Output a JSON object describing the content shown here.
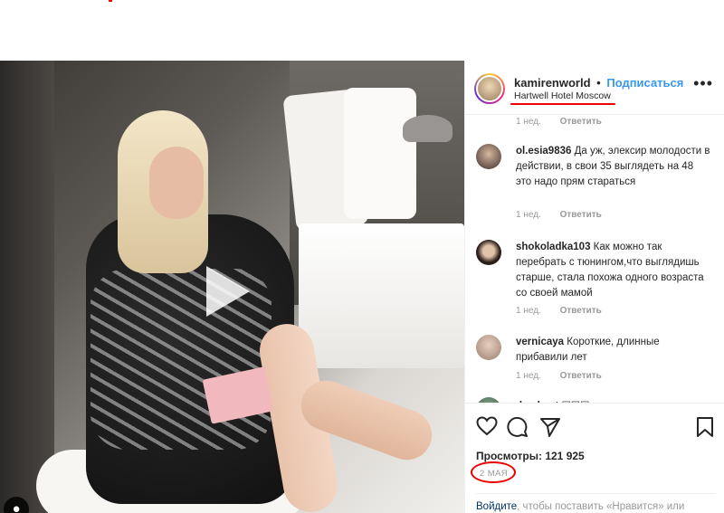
{
  "post": {
    "username": "kamirenworld",
    "dot": "•",
    "follow_label": "Подписаться",
    "location": "Hartwell Hotel Moscow",
    "more_icon": "more-horizontal-icon"
  },
  "comments": [
    {
      "username": "",
      "text": "",
      "time": "1 нед.",
      "reply": "Ответить"
    },
    {
      "username": "ol.esia9836",
      "text": "Да уж, элексир молодости в действии, в свои 35 выглядеть на 48 это надо прям стараться",
      "time": "1 нед.",
      "reply": "Ответить"
    },
    {
      "username": "shokoladka103",
      "text": "Как можно так перебрать с тюнингом,что выглядишь старше, стала похожа одного возраста со своей мамой",
      "time": "1 нед.",
      "reply": "Ответить"
    },
    {
      "username": "vernicaya",
      "text": "Короткие, длинные прибавили лет",
      "time": "1 нед.",
      "reply": "Ответить"
    },
    {
      "username": "dmckent",
      "text": "☐☐☐",
      "time": "",
      "reply": ""
    }
  ],
  "actions": {
    "like_icon": "heart-icon",
    "comment_icon": "comment-icon",
    "share_icon": "share-icon",
    "save_icon": "bookmark-icon"
  },
  "views_label": "Просмотры: 121 925",
  "date_label": "2 МАЯ",
  "login": {
    "link_text": "Войдите",
    "rest_text": ", чтобы поставить «Нравится» или прокомментировать."
  },
  "colors": {
    "link_blue": "#3897f0",
    "annotation_red": "#e00",
    "meta_gray": "#999999"
  }
}
